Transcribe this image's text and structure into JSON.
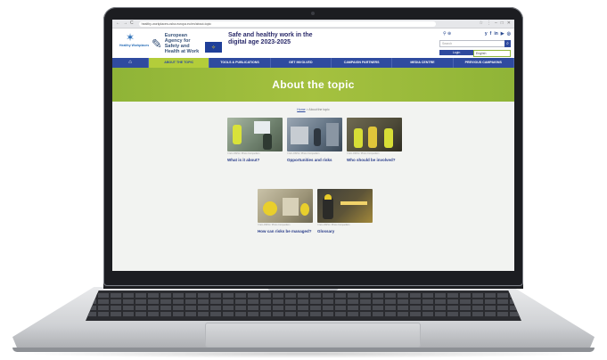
{
  "browser": {
    "url": "healthy-workplaces.osha.europa.eu/en/about-topic",
    "nav_back": "←",
    "nav_forward": "→",
    "nav_reload": "C",
    "controls": [
      "☆",
      "⋮",
      "–",
      "□",
      "✕"
    ]
  },
  "header": {
    "hw_logo_text": "Healthy Workplaces",
    "agency_name": "European Agency for Safety and Health at Work",
    "campaign_title": "Safe and healthy work in the digital age 2023-2025",
    "search_placeholder": "Search",
    "search_icon": "search-icon",
    "login_label": "Login",
    "language": "English",
    "social": [
      "y",
      "f",
      "in",
      "▶",
      "◎"
    ]
  },
  "nav": {
    "home_icon": "home-icon",
    "items": [
      "ABOUT THE TOPIC",
      "TOOLS & PUBLICATIONS",
      "GET INVOLVED",
      "CAMPAIGN PARTNERS",
      "MEDIA CENTRE",
      "PREVIOUS CAMPAIGNS"
    ],
    "active_index": 0
  },
  "hero": {
    "title": "About the topic"
  },
  "breadcrumb": {
    "home": "Home",
    "separator": ">",
    "current": "About the topic"
  },
  "cards": [
    {
      "label": "What is it about?",
      "caption": "© EU-OSHA / Photo Competition"
    },
    {
      "label": "Opportunities and risks",
      "caption": "© EU-OSHA / Photo Competition"
    },
    {
      "label": "Who should be involved?",
      "caption": "© EU-OSHA / Photo Competition"
    },
    {
      "label": "How can risks be managed?",
      "caption": "© EU-OSHA / Photo Competition"
    },
    {
      "label": "Glossary",
      "caption": "© EU-OSHA / Photo Competition"
    }
  ],
  "colors": {
    "nav_blue": "#2f4b9f",
    "hero_green": "#a5c13f",
    "link_blue": "#2a3d8a"
  }
}
